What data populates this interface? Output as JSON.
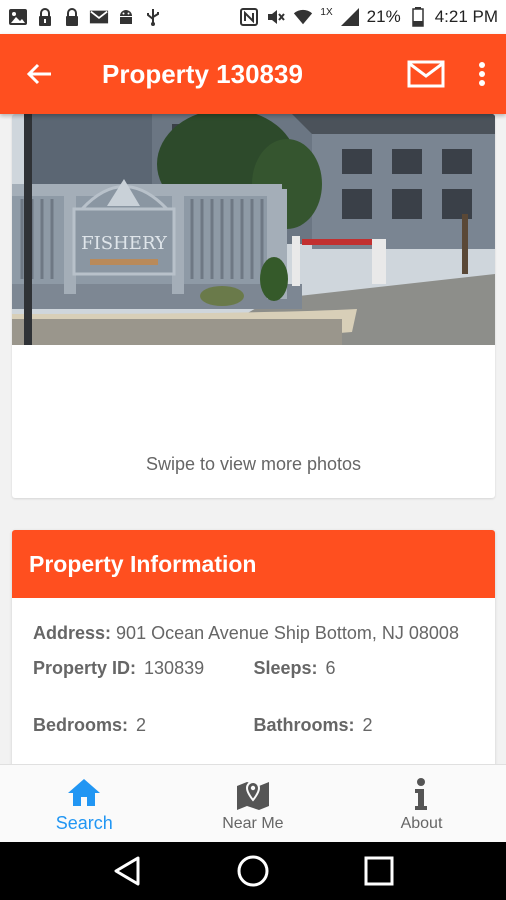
{
  "status_bar": {
    "battery": "21%",
    "time": "4:21 PM",
    "network_label": "1X"
  },
  "app_bar": {
    "title": "Property 130839",
    "color": "#ff4f1f"
  },
  "gallery": {
    "sign_text": "FISHERY",
    "swipe_hint": "Swipe to view more photos"
  },
  "property_info": {
    "header": "Property Information",
    "address_label": "Address:",
    "address_value": "901 Ocean Avenue Ship Bottom, NJ 08008",
    "property_id_label": "Property ID:",
    "property_id_value": "130839",
    "sleeps_label": "Sleeps:",
    "sleeps_value": "6",
    "bedrooms_label": "Bedrooms:",
    "bedrooms_value": "2",
    "bathrooms_label": "Bathrooms:",
    "bathrooms_value": "2"
  },
  "bottom_nav": {
    "items": [
      {
        "label": "Search",
        "icon": "home-icon",
        "active": true
      },
      {
        "label": "Near Me",
        "icon": "map-pin-icon",
        "active": false
      },
      {
        "label": "About",
        "icon": "info-icon",
        "active": false
      }
    ],
    "active_color": "#2196f3"
  },
  "system_nav": {
    "icons": [
      "back-triangle-icon",
      "home-circle-icon",
      "recents-square-icon"
    ]
  }
}
